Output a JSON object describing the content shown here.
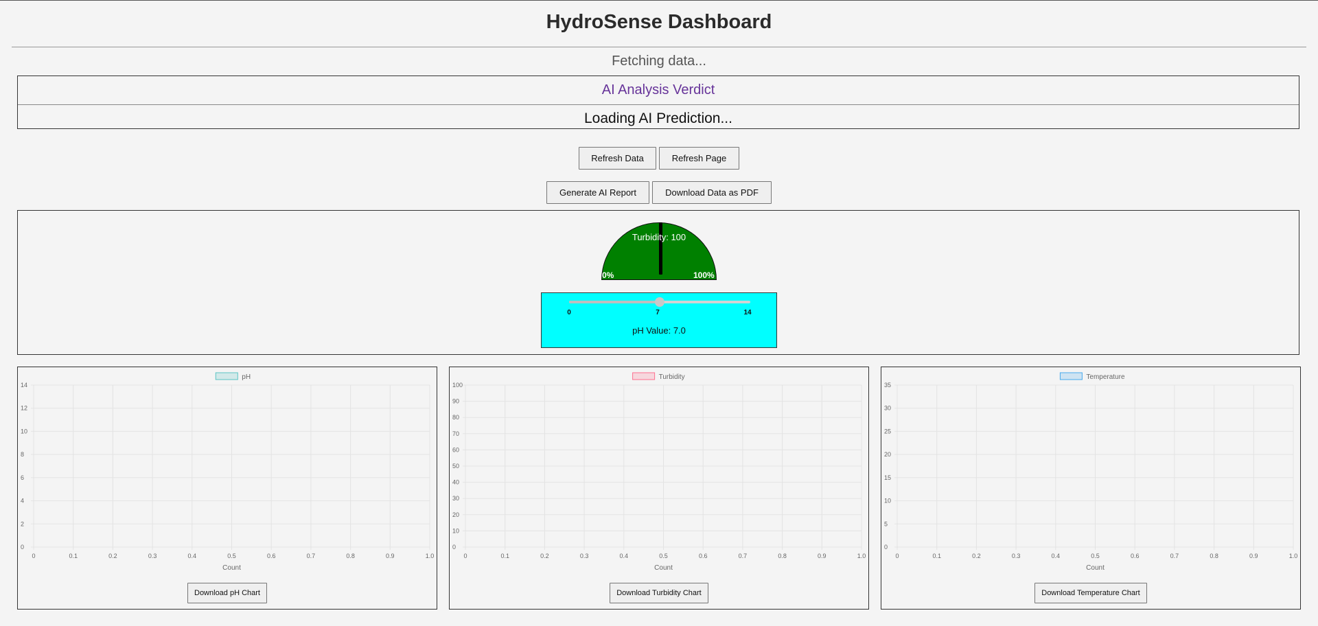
{
  "header": {
    "title": "HydroSense Dashboard",
    "status": "Fetching data..."
  },
  "ai": {
    "heading": "AI Analysis Verdict",
    "prediction": "Loading AI Prediction..."
  },
  "buttons": {
    "refresh_data": "Refresh Data",
    "refresh_page": "Refresh Page",
    "generate_report": "Generate AI Report",
    "download_pdf": "Download Data as PDF"
  },
  "gauge": {
    "label": "Turbidity: 100",
    "min_label": "0%",
    "max_label": "100%",
    "value": 100,
    "color": "#008000"
  },
  "ph_slider": {
    "min": "0",
    "mid": "7",
    "max": "14",
    "value": 7.0,
    "value_label": "pH Value: 7.0",
    "bg_color": "#00ffff"
  },
  "charts": [
    {
      "download_label": "Download pH Chart",
      "chart_data": {
        "type": "line",
        "series": [
          {
            "name": "pH",
            "values": []
          }
        ],
        "legend_color": "#4bc0c0",
        "xlabel": "Count",
        "ylabel": "",
        "xlim": [
          0,
          1
        ],
        "ylim": [
          0,
          14
        ],
        "x_ticks": [
          "0",
          "0.1",
          "0.2",
          "0.3",
          "0.4",
          "0.5",
          "0.6",
          "0.7",
          "0.8",
          "0.9",
          "1.0"
        ],
        "y_ticks": [
          "0",
          "2",
          "4",
          "6",
          "8",
          "10",
          "12",
          "14"
        ],
        "grid": true,
        "legend": "top"
      }
    },
    {
      "download_label": "Download Turbidity Chart",
      "chart_data": {
        "type": "line",
        "series": [
          {
            "name": "Turbidity",
            "values": []
          }
        ],
        "legend_color": "#ff6384",
        "xlabel": "Count",
        "ylabel": "",
        "xlim": [
          0,
          1
        ],
        "ylim": [
          0,
          100
        ],
        "x_ticks": [
          "0",
          "0.1",
          "0.2",
          "0.3",
          "0.4",
          "0.5",
          "0.6",
          "0.7",
          "0.8",
          "0.9",
          "1.0"
        ],
        "y_ticks": [
          "0",
          "10",
          "20",
          "30",
          "40",
          "50",
          "60",
          "70",
          "80",
          "90",
          "100"
        ],
        "grid": true,
        "legend": "top"
      }
    },
    {
      "download_label": "Download Temperature Chart",
      "chart_data": {
        "type": "line",
        "series": [
          {
            "name": "Temperature",
            "values": []
          }
        ],
        "legend_color": "#36a2eb",
        "xlabel": "Count",
        "ylabel": "",
        "xlim": [
          0,
          1
        ],
        "ylim": [
          0,
          35
        ],
        "x_ticks": [
          "0",
          "0.1",
          "0.2",
          "0.3",
          "0.4",
          "0.5",
          "0.6",
          "0.7",
          "0.8",
          "0.9",
          "1.0"
        ],
        "y_ticks": [
          "0",
          "5",
          "10",
          "15",
          "20",
          "25",
          "30",
          "35"
        ],
        "grid": true,
        "legend": "top"
      }
    }
  ]
}
